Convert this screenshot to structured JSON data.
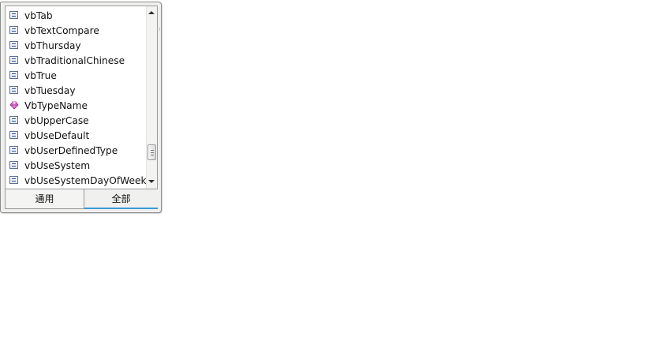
{
  "list": {
    "items": [
      {
        "label": "vbTab",
        "icon": "constant-icon"
      },
      {
        "label": "vbTextCompare",
        "icon": "constant-icon"
      },
      {
        "label": "vbThursday",
        "icon": "constant-icon"
      },
      {
        "label": "vbTraditionalChinese",
        "icon": "constant-icon"
      },
      {
        "label": "vbTrue",
        "icon": "constant-icon"
      },
      {
        "label": "vbTuesday",
        "icon": "constant-icon"
      },
      {
        "label": "VbTypeName",
        "icon": "class-icon"
      },
      {
        "label": "vbUpperCase",
        "icon": "constant-icon"
      },
      {
        "label": "vbUseDefault",
        "icon": "constant-icon"
      },
      {
        "label": "vbUserDefinedType",
        "icon": "constant-icon"
      },
      {
        "label": "vbUseSystem",
        "icon": "constant-icon"
      },
      {
        "label": "vbUseSystemDayOfWeek",
        "icon": "constant-icon"
      }
    ]
  },
  "tabs": {
    "common": "通用",
    "all": "全部",
    "selected": "all"
  },
  "colors": {
    "active_tab_accent": "#3b9ad9",
    "constant_icon": "#2b4f8c",
    "class_icon": "#c03fb0"
  }
}
